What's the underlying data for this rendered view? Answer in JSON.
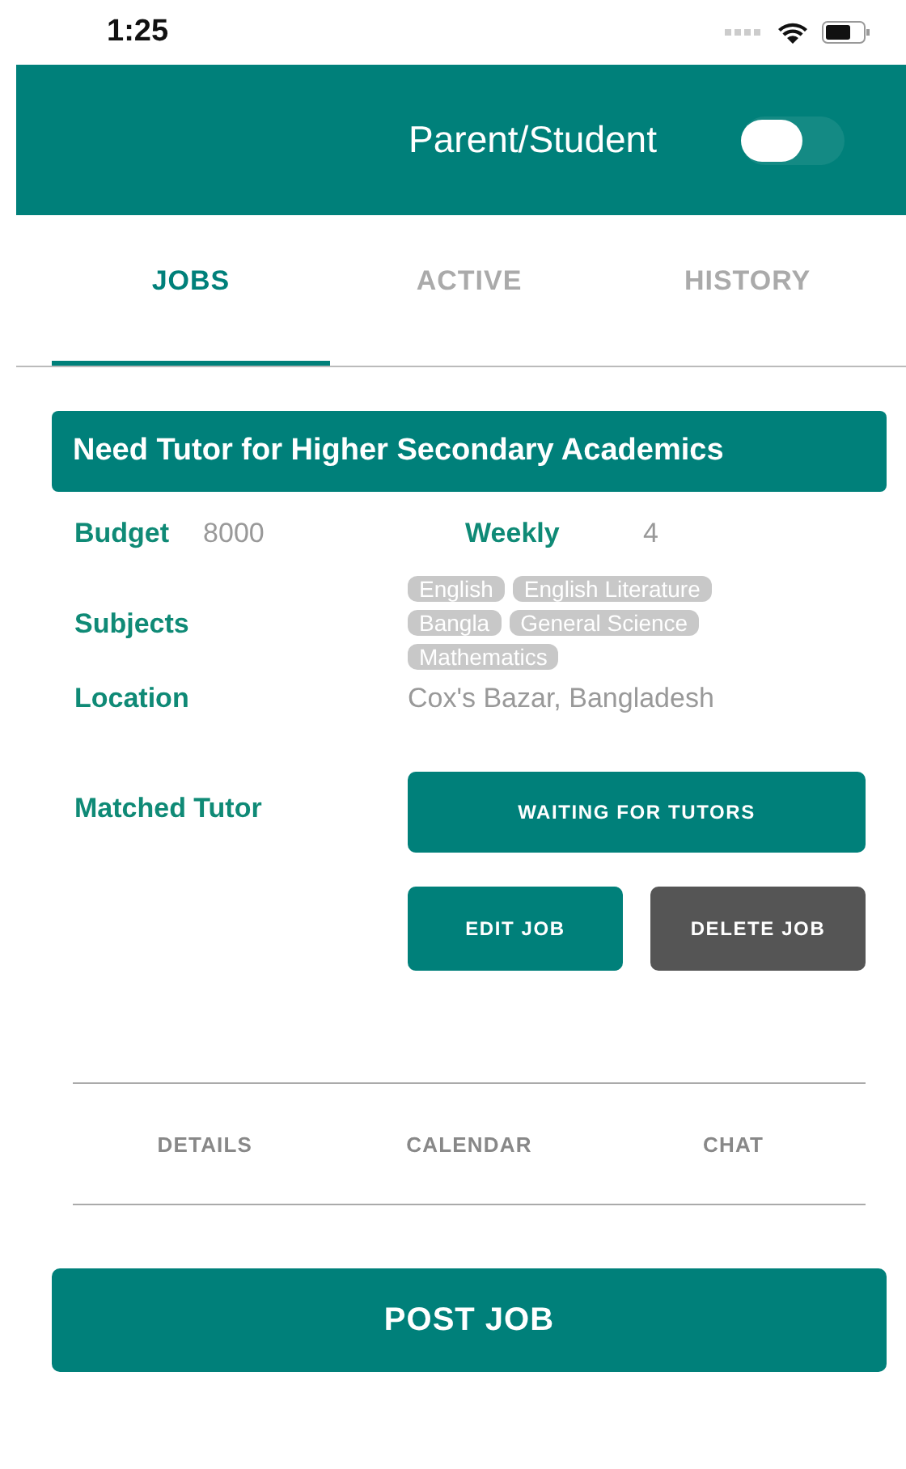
{
  "status_bar": {
    "time": "1:25"
  },
  "header": {
    "title": "Parent/Student",
    "toggle": {
      "on": false
    }
  },
  "tabs": [
    {
      "label": "JOBS",
      "selected": true
    },
    {
      "label": "ACTIVE",
      "selected": false
    },
    {
      "label": "HISTORY",
      "selected": false
    }
  ],
  "job": {
    "title": "Need Tutor for Higher Secondary Academics",
    "budget_label": "Budget",
    "budget": "8000",
    "weekly_label": "Weekly",
    "weekly": "4",
    "subjects_label": "Subjects",
    "subjects": [
      "English",
      "English Literature",
      "Bangla",
      "General Science",
      "Mathematics"
    ],
    "location_label": "Location",
    "location": "Cox's Bazar, Bangladesh",
    "matched_label": "Matched Tutor",
    "status_button": "WAITING FOR TUTORS",
    "actions": [
      {
        "label": "EDIT JOB",
        "kind": "primary"
      },
      {
        "label": "DELETE JOB",
        "kind": "danger"
      }
    ]
  },
  "bottom_tabs": [
    {
      "label": "DETAILS"
    },
    {
      "label": "CALENDAR"
    },
    {
      "label": "CHAT"
    }
  ],
  "post_button": "POST JOB"
}
